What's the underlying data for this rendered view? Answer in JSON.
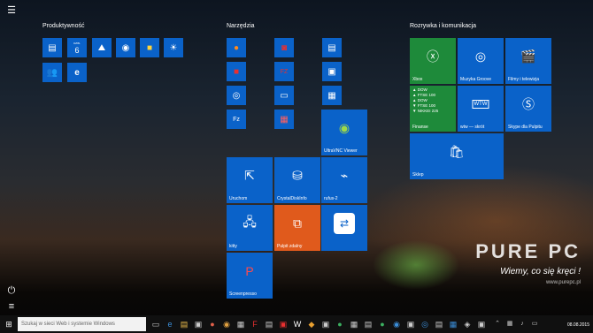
{
  "start_menu": {
    "groups": [
      {
        "title": "Produktywność"
      },
      {
        "title": "Narzędzia"
      },
      {
        "title": "Rozrywka i komunikacja"
      }
    ],
    "calendar": {
      "day": "czw.",
      "date": "6"
    },
    "tiles": {
      "finance": {
        "lines": [
          "▲ DOW",
          "▲ FTSE 100",
          "▲ DOW",
          "▼ FTSE 100",
          "▼ NIKKEI 225"
        ],
        "label": "Finanse"
      },
      "xbox": "Xbox",
      "groove": "Muzyka Groove",
      "films": "Filmy i telewizja",
      "wtw": "wtw — skrót",
      "skype": "Skype dla Pulpitu",
      "store": "Sklep",
      "ultravnc": "UltraVNC Viewer",
      "uruchom": "Uruchom",
      "crystal": "CrystalDiskInfo",
      "rufus": "rufus-2",
      "kitty": "kitty",
      "pulpit": "Pulpit zdalny",
      "screenpresso": "Screenpresso",
      "wtw_icon_text": "WTW"
    }
  },
  "taskbar": {
    "search_placeholder": "Szukaj w sieci Web i systemie Windows",
    "date": "08.08.2015"
  },
  "watermark": {
    "logo": "PURE PC",
    "slogan": "Wiemy, co się kręci !",
    "url": "www.purepc.pl"
  },
  "colors": {
    "tile_blue": "#0a62c9",
    "tile_green": "#1e8a3a",
    "tile_orange": "#e05a1c"
  }
}
